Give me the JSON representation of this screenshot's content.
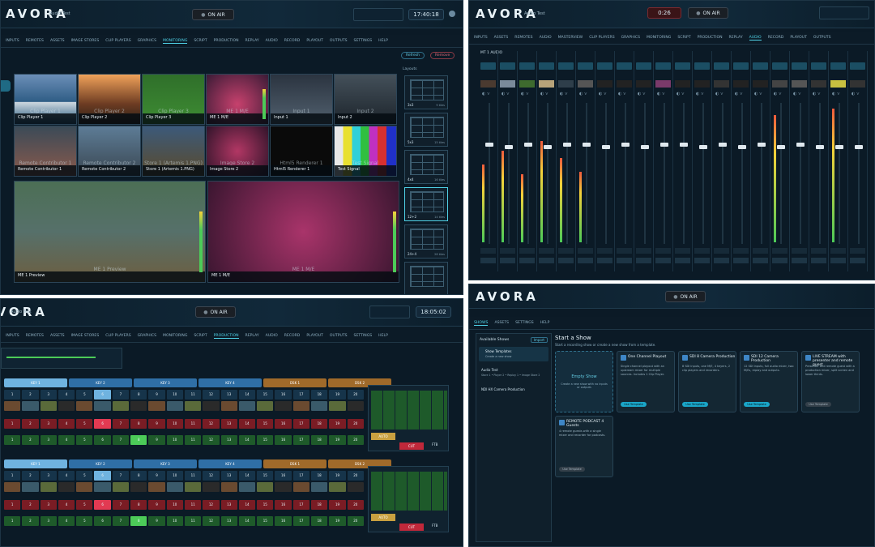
{
  "app": {
    "logo": "AVORA",
    "show_name": "Audio Test",
    "onair_label": "ON AIR"
  },
  "p1": {
    "clock": "17:40:18",
    "tabs": [
      "INPUTS",
      "REMOTES",
      "ASSETS",
      "IMAGE STORES",
      "CLIP PLAYERS",
      "GRAPHICS",
      "MONITORING",
      "SCRIPT",
      "PRODUCTION",
      "REPLAY",
      "AUDIO",
      "RECORD",
      "PLAYOUT",
      "OUTPUTS",
      "SETTINGS",
      "HELP"
    ],
    "active_tab": "MONITORING",
    "refresh": "Refresh",
    "remove": "Remove",
    "layouts_label": "Layouts",
    "tiles": [
      {
        "big": "Clip Player 1",
        "label": "Clip Player 1",
        "sub": ""
      },
      {
        "big": "Clip Player 2",
        "label": "Clip Player 2",
        "sub": ""
      },
      {
        "big": "Clip Player 3",
        "label": "Clip Player 3",
        "sub": ""
      },
      {
        "big": "ME 1 M/E",
        "label": "ME 1 M/E",
        "sub": ""
      },
      {
        "big": "Input 1",
        "label": "Input 1",
        "sub": ""
      },
      {
        "big": "Input 2",
        "label": "Input 2",
        "sub": ""
      },
      {
        "big": "Remote Contributor 1",
        "label": "Remote Contributor 1",
        "sub": ""
      },
      {
        "big": "Remote Contributor 2",
        "label": "Remote Contributor 2",
        "sub": ""
      },
      {
        "big": "Store 1 (Artemis 1.PNG)",
        "label": "Store 1 (Artemis 1.PNG)",
        "sub": ""
      },
      {
        "big": "Image Store 2",
        "label": "Image Store 2",
        "sub": ""
      },
      {
        "big": "Html5 Renderer 1",
        "label": "Html5 Renderer 1",
        "sub": ""
      },
      {
        "big": "Test Signal",
        "label": "Test Signal",
        "sub": ""
      },
      {
        "big": "ME 1 Preview",
        "label": "ME 1 Preview",
        "sub": ""
      },
      {
        "big": "ME 1 M/E",
        "label": "ME 1 M/E",
        "sub": ""
      }
    ],
    "layouts": [
      {
        "name": "3x3",
        "count": "9 tiles"
      },
      {
        "name": "5x3",
        "count": "15 tiles"
      },
      {
        "name": "4x4",
        "count": "16 tiles"
      },
      {
        "name": "12+2",
        "count": "14 tiles"
      },
      {
        "name": "24+4",
        "count": "28 tiles"
      },
      {
        "name": "",
        "count": ""
      }
    ]
  },
  "p2": {
    "timer": "0:26",
    "tabs": [
      "INPUTS",
      "ASSETS",
      "REMOTES",
      "AUDIO",
      "MASTERVIEW",
      "CLIP PLAYERS",
      "GRAPHICS",
      "MONITORING",
      "SCRIPT",
      "PRODUCTION",
      "REPLAY",
      "AUDIO",
      "RECORD",
      "PLAYOUT",
      "OUTPUTS"
    ],
    "active_tab_index": 11,
    "section": "MT 1 AUDIO",
    "levels": [
      0.55,
      0.65,
      0.48,
      0.72,
      0.6,
      0.5,
      0,
      0,
      0,
      0,
      0,
      0,
      0,
      0,
      0,
      0.9,
      0,
      0,
      0.95,
      0
    ],
    "faders": [
      0.72,
      0.7,
      0.72,
      0.7,
      0.72,
      0.72,
      0.7,
      0.72,
      0.7,
      0.72,
      0.72,
      0.7,
      0.72,
      0.7,
      0.72,
      0.7,
      0.72,
      0.7,
      0.7,
      0.7
    ]
  },
  "p3": {
    "clock": "18:05:02",
    "tabs": [
      "INPUTS",
      "REMOTES",
      "ASSETS",
      "IMAGE STORES",
      "CLIP PLAYERS",
      "GRAPHICS",
      "MONITORING",
      "SCRIPT",
      "PRODUCTION",
      "REPLAY",
      "AUDIO",
      "RECORD",
      "PLAYOUT",
      "OUTPUTS",
      "SETTINGS",
      "HELP"
    ],
    "active_tab": "PRODUCTION",
    "banks_top": [
      "KEY 1",
      "KEY 2",
      "KEY 3",
      "KEY 4",
      "DSK 1",
      "DSK 2"
    ],
    "numbers": [
      "1",
      "2",
      "3",
      "4",
      "5",
      "6",
      "7",
      "8",
      "9",
      "10",
      "11",
      "12",
      "13",
      "14",
      "15",
      "16",
      "17",
      "18",
      "19",
      "20"
    ],
    "auto": "AUTO",
    "cut": "CUT",
    "ftb": "FTB"
  },
  "p4": {
    "logo": "AVORA",
    "tabs": [
      "SHOWS",
      "ASSETS",
      "SETTINGS",
      "HELP"
    ],
    "side_title": "Available Shows",
    "side_btn": "Import",
    "side_item": "Show Templates",
    "side_sub": "Create a new show",
    "side_show1": "Audio Test",
    "side_show1_desc": "Store 1 • Player 2 • Replay 1 • Image Store 2",
    "side_show2": "NDI HX Camera Production",
    "heading": "Start a Show",
    "sub": "Start a recording show or create a new show from a template.",
    "empty": "Empty Show",
    "empty_desc": "Create a new show with no inputs or outputs",
    "cards": [
      {
        "title": "One Channel Playout",
        "desc": "Single channel playout with an upstream mixer for multiple sources. Includes 1 Clip Player.",
        "btn": "Use Template",
        "on": true
      },
      {
        "title": "SDI 8 Camera Production",
        "desc": "8 SDI inputs, one M/E, 4 keyers, 2 clip players and recorders.",
        "btn": "Use Template",
        "on": true
      },
      {
        "title": "SDI 12 Camera Production",
        "desc": "12 SDI inputs, full audio mixer, two M/Es, replay and outputs.",
        "btn": "Use Template",
        "on": true
      },
      {
        "title": "LIVE STREAM with presenter and remote guest",
        "desc": "Presenter and remote guest with a production mixer, split screen and lower thirds.",
        "btn": "Use Template",
        "on": false
      },
      {
        "title": "REMOTE PODCAST 4 Guests",
        "desc": "4 remote guests with a single mixer and recorder for podcasts.",
        "btn": "Use Template",
        "on": false
      }
    ]
  }
}
